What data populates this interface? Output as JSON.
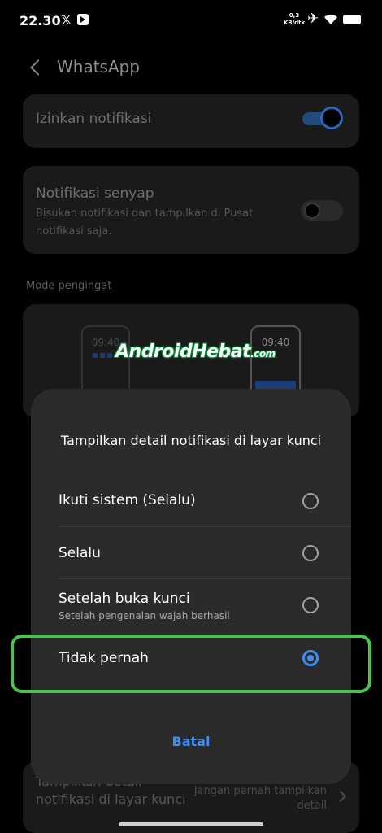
{
  "status_bar": {
    "time": "22.30",
    "x_glyph": "𝕏",
    "speed_value": "0,3",
    "speed_unit": "KB/dtk",
    "plane_glyph": "✈",
    "icons": [
      "x-icon",
      "app-notification-icon",
      "airplane-icon",
      "wifi-icon",
      "battery-icon"
    ]
  },
  "header": {
    "title": "WhatsApp",
    "back_icon": "chevron-left-icon"
  },
  "settings": {
    "allow_notifications": {
      "label": "Izinkan notifikasi",
      "enabled": true
    },
    "silent_notifications": {
      "label": "Notifikasi senyap",
      "description": "Bisukan notifikasi dan tampilkan di Pusat notifikasi saja.",
      "enabled": false
    },
    "reminder_mode": {
      "section_label": "Mode pengingat",
      "preview_time_left": "09:40",
      "preview_time_right": "09:40"
    },
    "lockscreen_details": {
      "label": "Tampilkan detail notifikasi di layar kunci",
      "value": "Jangan pernah tampilkan detail"
    }
  },
  "watermark": {
    "text": "AndroidHebat",
    "suffix": ".com"
  },
  "dialog": {
    "title": "Tampilkan detail notifikasi di layar kunci",
    "options": [
      {
        "label": "Ikuti sistem (Selalu)",
        "sublabel": "",
        "selected": false
      },
      {
        "label": "Selalu",
        "sublabel": "",
        "selected": false
      },
      {
        "label": "Setelah buka kunci",
        "sublabel": "Setelah pengenalan wajah berhasil",
        "selected": false
      },
      {
        "label": "Tidak pernah",
        "sublabel": "",
        "selected": true
      }
    ],
    "cancel_label": "Batal"
  },
  "colors": {
    "accent": "#3d8ef0",
    "highlight": "#4cc24f",
    "dialog_bg": "#2b2b2b",
    "page_bg": "#000000"
  }
}
